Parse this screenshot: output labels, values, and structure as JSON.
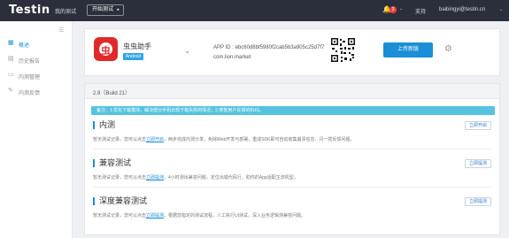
{
  "topbar": {
    "logo": "Testin",
    "my_tests": "我的测试",
    "start_test": "开始测试",
    "notification_count": "3",
    "support": "支持",
    "email": "baibingyi@testin.cn"
  },
  "sidebar": {
    "items": [
      {
        "label": "概述",
        "icon": "grid-icon",
        "active": true
      },
      {
        "label": "历史报告",
        "icon": "document-icon",
        "active": false
      },
      {
        "label": "内测管理",
        "icon": "monitor-icon",
        "active": false
      },
      {
        "label": "内测反馈",
        "icon": "feedback-icon",
        "active": false
      }
    ]
  },
  "app": {
    "name": "虫虫助手",
    "icon_glyph": "虫",
    "platform": "Android",
    "app_id": "APP ID : ebc60d8bf5980f2cab5b3a905c25d7f7",
    "package": "com.lion.market",
    "upload_label": "上传新版"
  },
  "main": {
    "version": "2.9（Build 21）",
    "note": "备注：1.优化下载模块，解决部分手机出现下载失败的情况；2.修复用户反馈的BUG。",
    "sections": [
      {
        "title": "内测",
        "button": "立即开启",
        "desc_before": "暂无测试记录，您可以点击",
        "link": "立即开启",
        "desc_after": "，两步完成内测分发，免除Web开发与部署，重成SDK即可自动收集崩溃信息、闪一揽反馈问题。"
      },
      {
        "title": "兼容测试",
        "button": "立即提测",
        "desc_before": "暂无测试记录，您可以点击",
        "link": "立即提测",
        "desc_after": "，4小时测出兼容问题，定位出错代码行，助你的App适配主流机型。"
      },
      {
        "title": "深度兼容测试",
        "button": "立即提测",
        "desc_before": "暂无测试记录，您可以点击",
        "link": "立即提测",
        "desc_after": "，根据您指定的测试流程，人工执行UI测试，深入业务逻辑测兼容问题。"
      }
    ]
  },
  "colors": {
    "accent": "#1a8fd8",
    "topbar": "#2b2f3b",
    "note_bg": "#55c3e0",
    "app_icon": "#e02a2a"
  }
}
